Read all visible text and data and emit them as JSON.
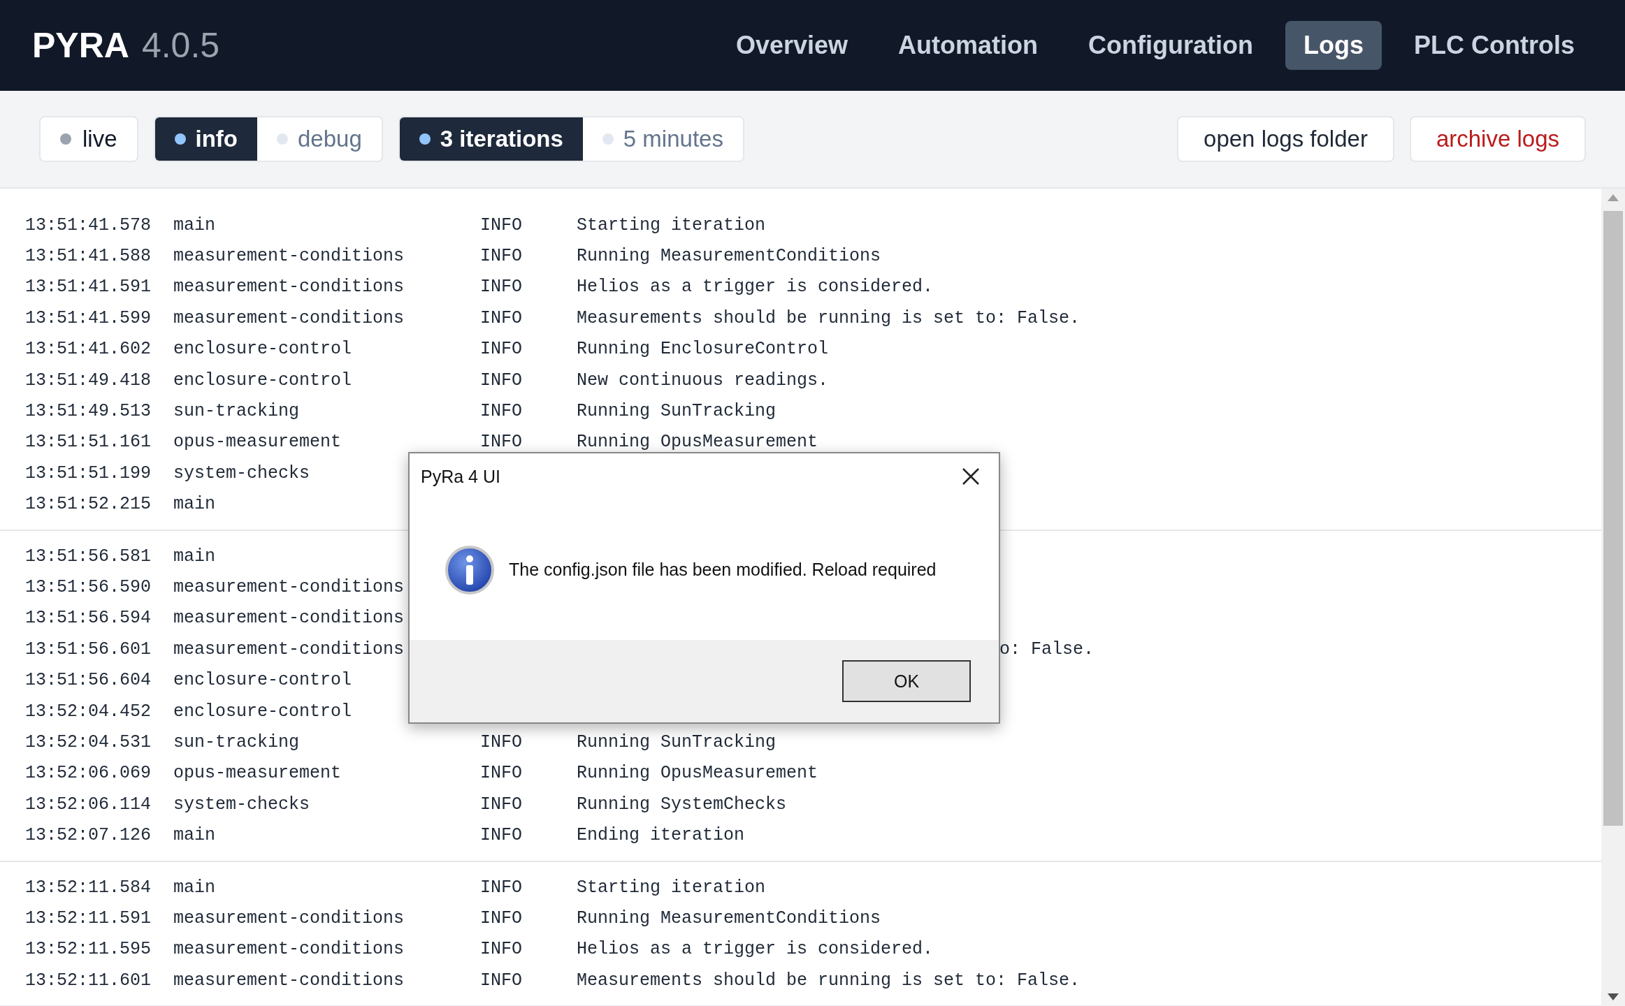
{
  "app": {
    "name": "PYRA",
    "version": "4.0.5"
  },
  "nav": [
    {
      "label": "Overview",
      "selected": false
    },
    {
      "label": "Automation",
      "selected": false
    },
    {
      "label": "Configuration",
      "selected": false
    },
    {
      "label": "Logs",
      "selected": true
    },
    {
      "label": "PLC Controls",
      "selected": false
    }
  ],
  "toolbar": {
    "live": {
      "label": "live",
      "on": false
    },
    "level_filter": [
      {
        "label": "info",
        "selected": true
      },
      {
        "label": "debug",
        "selected": false
      }
    ],
    "range_filter": [
      {
        "label": "3 iterations",
        "selected": true
      },
      {
        "label": "5 minutes",
        "selected": false
      }
    ],
    "actions": [
      {
        "label": "open logs folder",
        "kind": "plain"
      },
      {
        "label": "archive logs",
        "kind": "danger"
      }
    ]
  },
  "log_groups": [
    {
      "rows": [
        {
          "kind": "full",
          "time": "13:51:41.578",
          "module": "main",
          "level": "INFO",
          "message": "Starting iteration"
        },
        {
          "kind": "full",
          "time": "13:51:41.588",
          "module": "measurement-conditions",
          "level": "INFO",
          "message": "Running MeasurementConditions"
        },
        {
          "kind": "full",
          "time": "13:51:41.591",
          "module": "measurement-conditions",
          "level": "INFO",
          "message": "Helios as a trigger is considered."
        },
        {
          "kind": "full",
          "time": "13:51:41.599",
          "module": "measurement-conditions",
          "level": "INFO",
          "message": "Measurements should be running is set to: False."
        },
        {
          "kind": "full",
          "time": "13:51:41.602",
          "module": "enclosure-control",
          "level": "INFO",
          "message": "Running EnclosureControl"
        },
        {
          "kind": "full",
          "time": "13:51:49.418",
          "module": "enclosure-control",
          "level": "INFO",
          "message": "New continuous readings."
        },
        {
          "kind": "full",
          "time": "13:51:49.513",
          "module": "sun-tracking",
          "level": "INFO",
          "message": "Running SunTracking"
        },
        {
          "kind": "full",
          "time": "13:51:51.161",
          "module": "opus-measurement",
          "level": "INFO",
          "message": "Running OpusMeasurement"
        },
        {
          "kind": "covered",
          "time": "13:51:51.199",
          "module": "system-checks"
        },
        {
          "kind": "covered",
          "time": "13:51:52.215",
          "module": "main"
        }
      ]
    },
    {
      "rows": [
        {
          "kind": "covered",
          "time": "13:51:56.581",
          "module": "main"
        },
        {
          "kind": "covered",
          "time": "13:51:56.590",
          "module": "measurement-conditions"
        },
        {
          "kind": "covered",
          "time": "13:51:56.594",
          "module": "measurement-conditions"
        },
        {
          "kind": "covered",
          "time": "13:51:56.601",
          "module": "measurement-conditions",
          "message": "o: False."
        },
        {
          "kind": "covered",
          "time": "13:51:56.604",
          "module": "enclosure-control"
        },
        {
          "kind": "covered",
          "time": "13:52:04.452",
          "module": "enclosure-control"
        },
        {
          "kind": "full",
          "time": "13:52:04.531",
          "module": "sun-tracking",
          "level": "INFO",
          "message": "Running SunTracking"
        },
        {
          "kind": "full",
          "time": "13:52:06.069",
          "module": "opus-measurement",
          "level": "INFO",
          "message": "Running OpusMeasurement"
        },
        {
          "kind": "full",
          "time": "13:52:06.114",
          "module": "system-checks",
          "level": "INFO",
          "message": "Running SystemChecks"
        },
        {
          "kind": "full",
          "time": "13:52:07.126",
          "module": "main",
          "level": "INFO",
          "message": "Ending iteration"
        }
      ]
    },
    {
      "rows": [
        {
          "kind": "full",
          "time": "13:52:11.584",
          "module": "main",
          "level": "INFO",
          "message": "Starting iteration"
        },
        {
          "kind": "full",
          "time": "13:52:11.591",
          "module": "measurement-conditions",
          "level": "INFO",
          "message": "Running MeasurementConditions"
        },
        {
          "kind": "full",
          "time": "13:52:11.595",
          "module": "measurement-conditions",
          "level": "INFO",
          "message": "Helios as a trigger is considered."
        },
        {
          "kind": "full",
          "time": "13:52:11.601",
          "module": "measurement-conditions",
          "level": "INFO",
          "message": "Measurements should be running is set to: False."
        }
      ]
    }
  ],
  "dialog": {
    "title": "PyRa 4 UI",
    "message": "The config.json file has been modified. Reload required",
    "button": "OK"
  }
}
